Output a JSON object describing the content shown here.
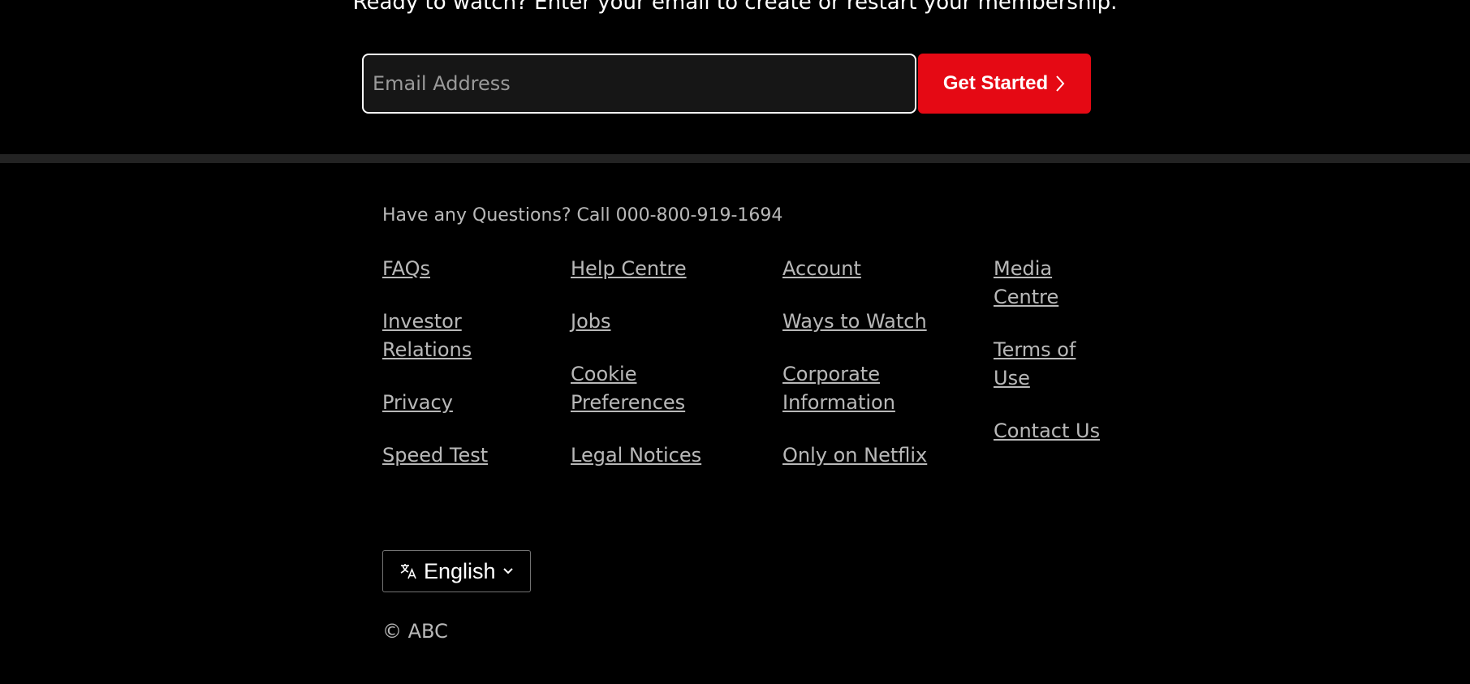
{
  "cta": {
    "text": "Ready to watch? Enter your email to create or restart your membership.",
    "email_placeholder": "Email Address",
    "get_started_label": "Get Started"
  },
  "colors": {
    "accent": "#e50914",
    "background": "#000000",
    "divider": "#232323"
  },
  "footer": {
    "question": "Have any Questions? Call 000-800-919-1694",
    "columns": [
      {
        "links": [
          {
            "label": "FAQs"
          },
          {
            "label": "Investor Relations"
          },
          {
            "label": "Privacy"
          },
          {
            "label": "Speed Test"
          }
        ]
      },
      {
        "links": [
          {
            "label": "Help Centre"
          },
          {
            "label": "Jobs"
          },
          {
            "label": "Cookie Preferences"
          },
          {
            "label": "Legal Notices"
          }
        ]
      },
      {
        "links": [
          {
            "label": "Account"
          },
          {
            "label": "Ways to Watch"
          },
          {
            "label": "Corporate Information"
          },
          {
            "label": "Only on Netflix"
          }
        ]
      },
      {
        "links": [
          {
            "label": "Media Centre"
          },
          {
            "label": "Terms of Use"
          },
          {
            "label": "Contact Us"
          }
        ]
      }
    ],
    "language": {
      "selected": "English",
      "icon": "translate-icon"
    },
    "copyright": "© ABC"
  }
}
